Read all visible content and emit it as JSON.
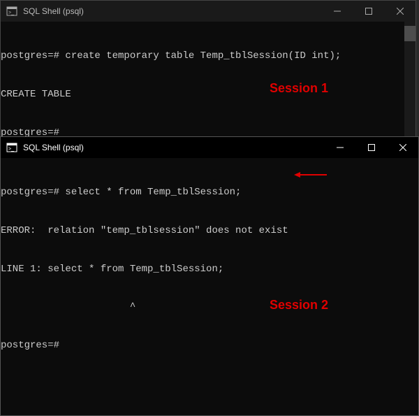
{
  "window1": {
    "title": "SQL Shell (psql)",
    "lines": {
      "l0": "postgres=# create temporary table Temp_tblSession(ID int);",
      "l1": "CREATE TABLE",
      "l2": "postgres=#"
    },
    "session_label": "Session 1"
  },
  "window2": {
    "title": "SQL Shell (psql)",
    "lines": {
      "l0": "postgres=# select * from Temp_tblSession;",
      "l1": "ERROR:  relation \"temp_tblsession\" does not exist",
      "l2": "LINE 1: select * from Temp_tblSession;",
      "l3": "                      ^",
      "l4": "postgres=#"
    },
    "session_label": "Session 2"
  },
  "colors": {
    "annotation": "#e00000"
  }
}
